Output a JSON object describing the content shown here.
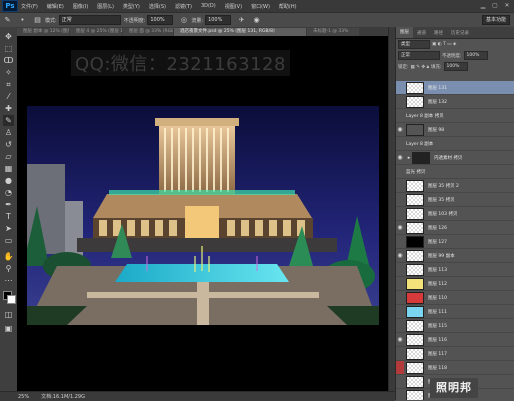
{
  "menubar": {
    "logo": "Ps",
    "items": [
      "文件(F)",
      "编辑(E)",
      "图像(I)",
      "图层(L)",
      "类型(Y)",
      "选择(S)",
      "滤镜(T)",
      "3D(D)",
      "视图(V)",
      "窗口(W)",
      "帮助(H)"
    ]
  },
  "options": {
    "mode_label": "模式:",
    "mode_value": "正常",
    "opacity_label": "不透明度:",
    "opacity_value": "100%",
    "flow_label": "流量:",
    "flow_value": "100%",
    "workspace": "基本功能"
  },
  "tabs": [
    {
      "label": "图层 副本 @ 12% (图层 124, RGB/8)",
      "active": false
    },
    {
      "label": "图层 4 @ 25% (图层 132, RGB/8)",
      "active": false
    },
    {
      "label": "图层 面 @ 33% (RGB/8)",
      "active": false
    },
    {
      "label": "酒店夜景文件.psd @ 25% (图层 131, RGB/8)",
      "active": true
    },
    {
      "label": "未标题-1 @ 33%",
      "active": false
    }
  ],
  "canvas": {
    "watermark": "QQ:微信：2321163128"
  },
  "status": {
    "zoom": "25%",
    "doc": "文档:16.1M/1.29G"
  },
  "panel": {
    "tabs": [
      "图层",
      "通道",
      "路径",
      "历史记录"
    ],
    "kind_label": "类型",
    "blend_value": "正常",
    "opacity_label": "不透明度:",
    "opacity_value": "100%",
    "lock_label": "锁定:",
    "fill_label": "填充:",
    "fill_value": "100%"
  },
  "layers": [
    {
      "name": "图层 131",
      "selected": true,
      "eye": false,
      "red": false,
      "group": false,
      "thumb": "checker"
    },
    {
      "name": "图层 132",
      "selected": false,
      "eye": false,
      "red": false,
      "group": false,
      "thumb": "checker"
    },
    {
      "name": "Layer 8 副本 拷贝",
      "selected": false,
      "eye": false,
      "red": false,
      "group": false,
      "thumb": "none"
    },
    {
      "name": "图层 98",
      "selected": false,
      "eye": true,
      "red": false,
      "group": false,
      "thumb": "photo"
    },
    {
      "name": "Layer 8 副本",
      "selected": false,
      "eye": false,
      "red": false,
      "group": false,
      "thumb": "none"
    },
    {
      "name": "内透素材 拷贝",
      "selected": false,
      "eye": true,
      "red": false,
      "group": true,
      "thumb": "dark"
    },
    {
      "name": "蓝光 拷贝",
      "selected": false,
      "eye": false,
      "red": false,
      "group": false,
      "thumb": "none"
    },
    {
      "name": "图层 35 拷贝 2",
      "selected": false,
      "eye": false,
      "red": false,
      "group": false,
      "thumb": "checker"
    },
    {
      "name": "图层 35 拷贝",
      "selected": false,
      "eye": false,
      "red": false,
      "group": false,
      "thumb": "checker"
    },
    {
      "name": "图层 103 拷贝",
      "selected": false,
      "eye": false,
      "red": false,
      "group": false,
      "thumb": "checker"
    },
    {
      "name": "图层 126",
      "selected": false,
      "eye": true,
      "red": false,
      "group": false,
      "thumb": "checker"
    },
    {
      "name": "图层 127",
      "selected": false,
      "eye": false,
      "red": false,
      "group": false,
      "thumb": "black"
    },
    {
      "name": "图层 99 副本",
      "selected": false,
      "eye": true,
      "red": false,
      "group": false,
      "thumb": "checker"
    },
    {
      "name": "图层 113",
      "selected": false,
      "eye": false,
      "red": false,
      "group": false,
      "thumb": "checker"
    },
    {
      "name": "图层 112",
      "selected": false,
      "eye": false,
      "red": false,
      "group": false,
      "thumb": "yellow"
    },
    {
      "name": "图层 110",
      "selected": false,
      "eye": false,
      "red": false,
      "group": false,
      "thumb": "red"
    },
    {
      "name": "图层 111",
      "selected": false,
      "eye": false,
      "red": false,
      "group": false,
      "thumb": "cyan"
    },
    {
      "name": "图层 115",
      "selected": false,
      "eye": false,
      "red": false,
      "group": false,
      "thumb": "checker"
    },
    {
      "name": "图层 116",
      "selected": false,
      "eye": true,
      "red": false,
      "group": false,
      "thumb": "checker"
    },
    {
      "name": "图层 117",
      "selected": false,
      "eye": false,
      "red": false,
      "group": false,
      "thumb": "checker"
    },
    {
      "name": "图层 118",
      "selected": false,
      "eye": false,
      "red": true,
      "group": false,
      "thumb": "checker"
    },
    {
      "name": "图层 119",
      "selected": false,
      "eye": false,
      "red": false,
      "group": false,
      "thumb": "checker"
    },
    {
      "name": "图层 120",
      "selected": false,
      "eye": false,
      "red": false,
      "group": false,
      "thumb": "checker"
    },
    {
      "name": "图层 121",
      "selected": false,
      "eye": false,
      "red": false,
      "group": false,
      "thumb": "checker"
    }
  ],
  "stamp": "照明邦"
}
